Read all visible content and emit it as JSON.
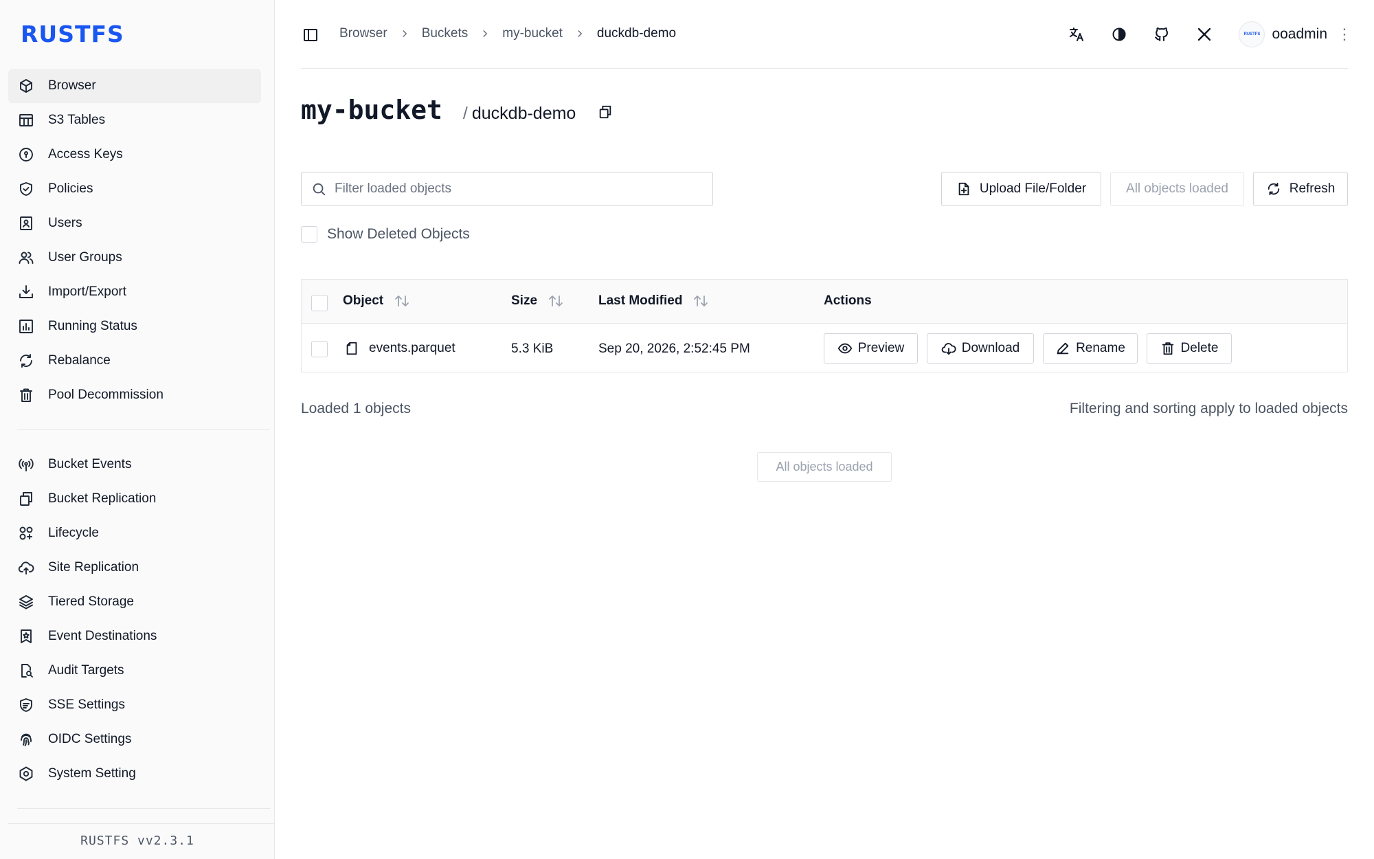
{
  "brand": {
    "logo_text": "RUSTFS",
    "accent_color": "#1a56f0",
    "version": "RUSTFS  vv2.3.1"
  },
  "sidebar": {
    "primary": [
      {
        "label": "Browser",
        "icon": "box-icon",
        "active": true
      },
      {
        "label": "S3 Tables",
        "icon": "table-icon"
      },
      {
        "label": "Access Keys",
        "icon": "key-circle-icon"
      },
      {
        "label": "Policies",
        "icon": "shield-check-icon"
      },
      {
        "label": "Users",
        "icon": "user-badge-icon"
      },
      {
        "label": "User Groups",
        "icon": "users-icon"
      },
      {
        "label": "Import/Export",
        "icon": "download-tray-icon"
      },
      {
        "label": "Running Status",
        "icon": "bar-chart-icon"
      },
      {
        "label": "Rebalance",
        "icon": "refresh-icon"
      },
      {
        "label": "Pool Decommission",
        "icon": "trash-icon"
      }
    ],
    "secondary": [
      {
        "label": "Bucket Events",
        "icon": "broadcast-icon"
      },
      {
        "label": "Bucket Replication",
        "icon": "copy-icon"
      },
      {
        "label": "Lifecycle",
        "icon": "lifecycle-icon"
      },
      {
        "label": "Site Replication",
        "icon": "cloud-upload-icon"
      },
      {
        "label": "Tiered Storage",
        "icon": "layers-icon"
      },
      {
        "label": "Event Destinations",
        "icon": "bookmark-star-icon"
      },
      {
        "label": "Audit Targets",
        "icon": "file-search-icon"
      },
      {
        "label": "SSE Settings",
        "icon": "encryption-icon"
      },
      {
        "label": "OIDC Settings",
        "icon": "fingerprint-icon"
      },
      {
        "label": "System Setting",
        "icon": "hexagon-gear-icon"
      }
    ]
  },
  "header": {
    "breadcrumbs": [
      "Browser",
      "Buckets",
      "my-bucket",
      "duckdb-demo"
    ],
    "icons": [
      "translate-icon",
      "theme-icon",
      "github-icon",
      "x-icon"
    ],
    "user": {
      "name": "ooadmin",
      "avatar_text": "RUSTFS"
    }
  },
  "page": {
    "bucket": "my-bucket",
    "path": "duckdb-demo",
    "filter_placeholder": "Filter loaded objects",
    "filter_value": "",
    "upload_label": "Upload File/Folder",
    "all_loaded_label": "All objects loaded",
    "refresh_label": "Refresh",
    "show_deleted_label": "Show Deleted Objects"
  },
  "table": {
    "columns": [
      "Object",
      "Size",
      "Last Modified",
      "Actions"
    ],
    "rows": [
      {
        "name": "events.parquet",
        "size": "5.3 KiB",
        "modified": "Sep 20, 2026, 2:52:45 PM"
      }
    ],
    "actions": [
      "Preview",
      "Download",
      "Rename",
      "Delete"
    ]
  },
  "footer": {
    "loaded_count": "Loaded 1 objects",
    "note": "Filtering and sorting apply to loaded objects",
    "all_loaded": "All objects loaded"
  }
}
